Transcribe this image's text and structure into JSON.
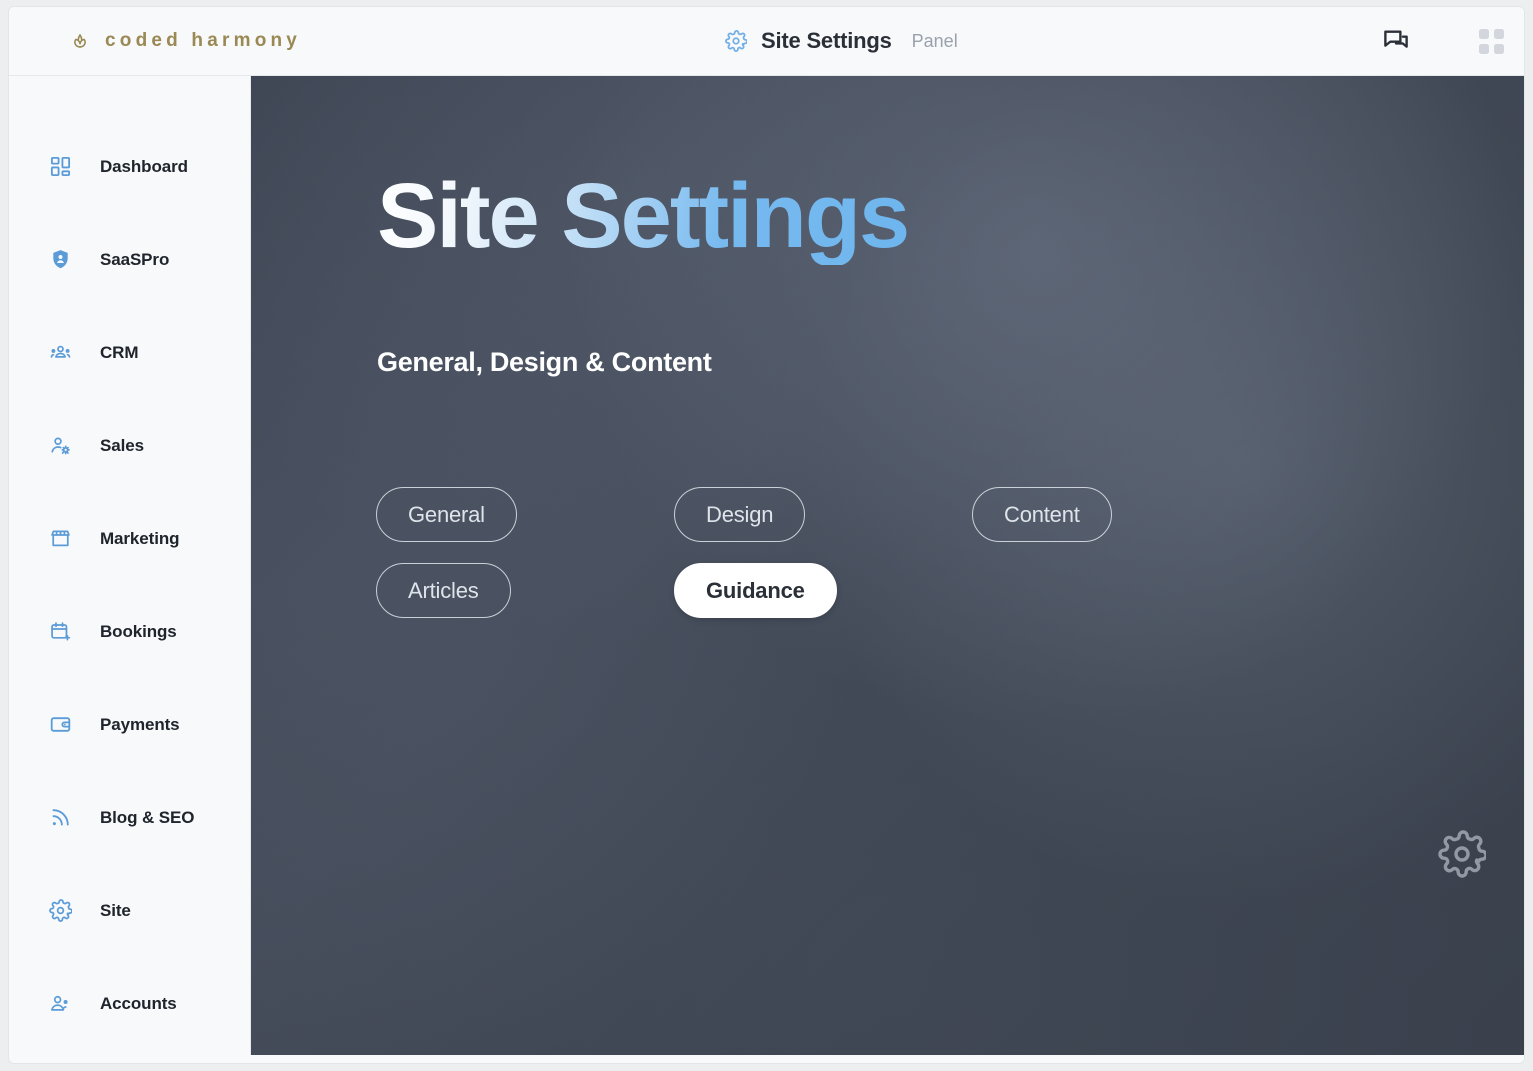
{
  "brand": {
    "icon": "lotus-icon",
    "name": "coded harmony",
    "color": "#9a8954"
  },
  "topbar": {
    "gear_icon": "gear-icon",
    "title": "Site Settings",
    "subtitle": "Panel",
    "chat_icon": "chat-bubbles-icon",
    "grid_icon": "apps-grid-icon",
    "accent_color": "#72aee6",
    "title_color": "#2b3038",
    "subtitle_color": "#9aa1ac"
  },
  "sidebar": {
    "icon_color": "#5a9bd8",
    "background": "#f8f9fa",
    "items": [
      {
        "label": "Dashboard",
        "icon": "dashboard-grid-icon"
      },
      {
        "label": "SaaSPro",
        "icon": "shield-user-icon"
      },
      {
        "label": "CRM",
        "icon": "contacts-group-icon"
      },
      {
        "label": "Sales",
        "icon": "user-settings-icon"
      },
      {
        "label": "Marketing",
        "icon": "storefront-icon"
      },
      {
        "label": "Bookings",
        "icon": "calendar-add-icon"
      },
      {
        "label": "Payments",
        "icon": "wallet-icon"
      },
      {
        "label": "Blog & SEO",
        "icon": "rss-feed-icon"
      },
      {
        "label": "Site",
        "icon": "gear-icon"
      },
      {
        "label": "Accounts",
        "icon": "user-group-icon"
      }
    ]
  },
  "main": {
    "hero_title": "Site Settings",
    "hero_subtitle": "General, Design & Content",
    "background_color": "#3e4553",
    "title_gradient_from": "#ffffff",
    "title_gradient_to": "#6fb6ee",
    "watermark_icon": "gear-icon",
    "tabs": [
      {
        "label": "General",
        "active": false
      },
      {
        "label": "Design",
        "active": false
      },
      {
        "label": "Content",
        "active": false
      },
      {
        "label": "Articles",
        "active": false
      },
      {
        "label": "Guidance",
        "active": true
      }
    ]
  }
}
